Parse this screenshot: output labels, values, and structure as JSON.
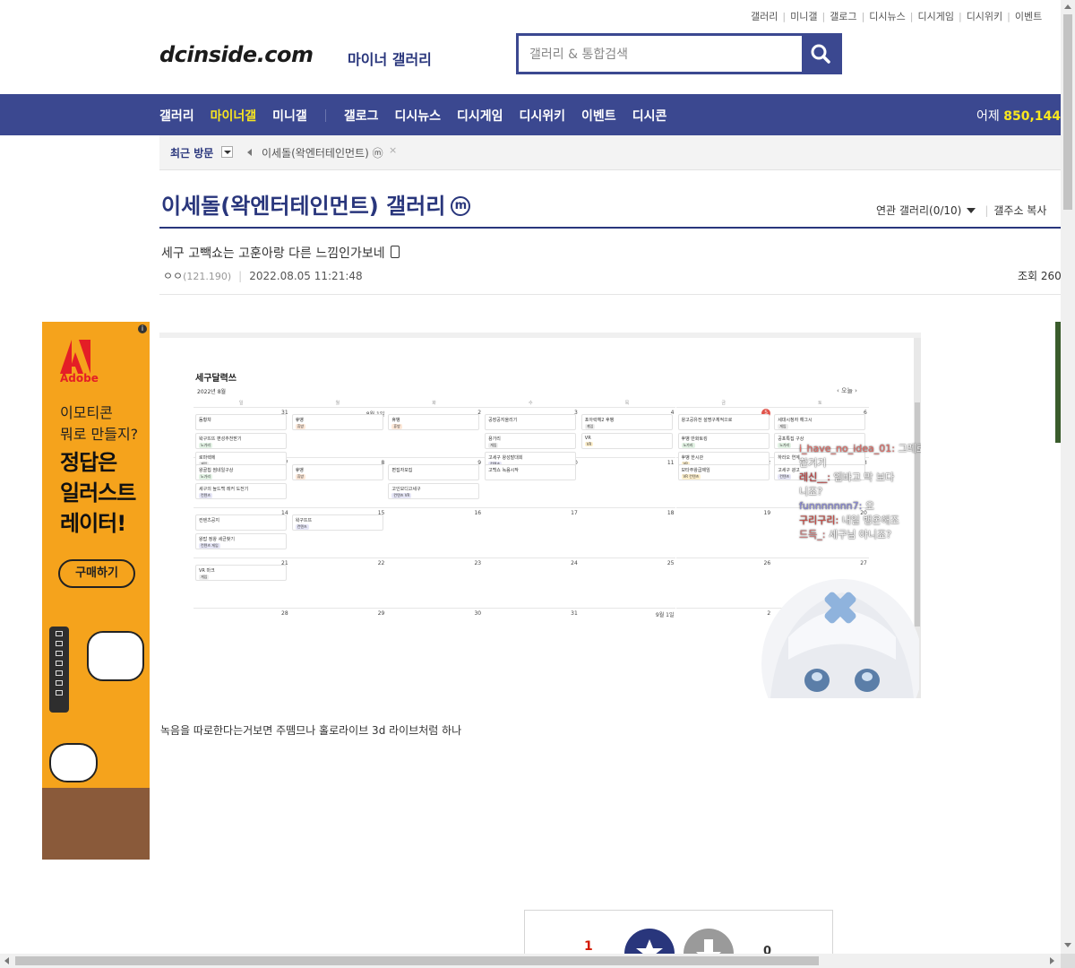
{
  "top_links": [
    "갤러리",
    "미니갤",
    "갤로그",
    "디시뉴스",
    "디시게임",
    "디시위키",
    "이벤트"
  ],
  "logo": {
    "text": "dcinside.com",
    "sub": "마이너 갤러리"
  },
  "search": {
    "placeholder": "갤러리 & 통합검색",
    "icon": "search-icon"
  },
  "nav": {
    "items": [
      "갤러리",
      "마이너갤",
      "미니갤",
      "갤로그",
      "디시뉴스",
      "디시게임",
      "디시위키",
      "이벤트",
      "디시콘"
    ],
    "active_index": 1,
    "yesterday_label": "어제",
    "yesterday_count": "850,144",
    "bg_color": "#3b4890",
    "active_color": "#f9e71f"
  },
  "recent": {
    "label": "최근 방문",
    "item": "이세돌(왁엔터테인먼트)",
    "item_badge": "ⓜ",
    "close": "×"
  },
  "gallery": {
    "title": "이세돌(왁엔터테인먼트) 갤러리",
    "minor_badge": "m",
    "related": "연관 갤러리(0/10)",
    "copy_address": "갤주소 복사"
  },
  "post": {
    "title": "세구 고빽쇼는 고훈아랑 다른 느낌인가보네",
    "author": "ㅇㅇ",
    "ip": "(121.190)",
    "datetime": "2022.08.05 11:21:48",
    "views": "조회 260",
    "body": "녹음을 따로한다는거보면 주뗌므나 홀로라이브 3d 라이브처럼 하나"
  },
  "embedded_image": {
    "calendar_title": "세구달력쓰",
    "calendar_month": "2022년 8월",
    "calendar_nav": "‹ 오늘 ›",
    "week_days": [
      "일",
      "월",
      "화",
      "수",
      "목",
      "금",
      "토"
    ],
    "weeks": [
      [
        "31",
        "8월 1일",
        "2",
        "3",
        "4",
        "5",
        "6"
      ],
      [
        "7",
        "8",
        "9",
        "10",
        "11",
        "12",
        "13"
      ],
      [
        "14",
        "15",
        "16",
        "17",
        "18",
        "19",
        "20"
      ],
      [
        "21",
        "22",
        "23",
        "24",
        "25",
        "26",
        "27"
      ],
      [
        "28",
        "29",
        "30",
        "31",
        "9월 1일",
        "2",
        "3"
      ]
    ],
    "events": [
      {
        "week": 0,
        "day": 0,
        "slot": 0,
        "text": "돔황챠",
        "tag": ""
      },
      {
        "week": 0,
        "day": 0,
        "slot": 1,
        "text": "왁구뜨뜨 편성추천받기",
        "tag": "노가리"
      },
      {
        "week": 0,
        "day": 0,
        "slot": 2,
        "text": "로마렉에",
        "tag": "게임"
      },
      {
        "week": 0,
        "day": 1,
        "slot": 0,
        "text": "휴뱅",
        "tag": "휴방"
      },
      {
        "week": 0,
        "day": 2,
        "slot": 0,
        "text": "휴뱅",
        "tag": "휴방"
      },
      {
        "week": 0,
        "day": 3,
        "slot": 0,
        "text": "공장공지올리기",
        "tag": ""
      },
      {
        "week": 0,
        "day": 3,
        "slot": 1,
        "text": "용가리",
        "tag": "게임"
      },
      {
        "week": 0,
        "day": 3,
        "slot": 2,
        "text": "고세구 왕성발대회",
        "tag": "컨텐츠"
      },
      {
        "week": 0,
        "day": 4,
        "slot": 0,
        "text": "포아락헤2 후뱅",
        "tag": "게임"
      },
      {
        "week": 0,
        "day": 4,
        "slot": 1,
        "text": "VR",
        "tag": "VR"
      },
      {
        "week": 0,
        "day": 5,
        "slot": 0,
        "text": "왕고공유전 설명구체적으로",
        "tag": ""
      },
      {
        "week": 0,
        "day": 5,
        "slot": 1,
        "text": "후뱅 만화토킹",
        "tag": "노가리"
      },
      {
        "week": 0,
        "day": 5,
        "slot": 2,
        "text": "후뱅 한시관",
        "tag": "VR"
      },
      {
        "week": 0,
        "day": 6,
        "slot": 0,
        "text": "세대시청자 해그시",
        "tag": "게임"
      },
      {
        "week": 0,
        "day": 6,
        "slot": 1,
        "text": "공포특집 구상",
        "tag": "노가리"
      },
      {
        "week": 0,
        "day": 6,
        "slot": 2,
        "text": "하라오 연계",
        "tag": ""
      },
      {
        "week": 1,
        "day": 0,
        "slot": 0,
        "text": "왕골칩 썸네일구상",
        "tag": "노가리"
      },
      {
        "week": 1,
        "day": 0,
        "slot": 1,
        "text": "세구의 늪드백 레커 도전기",
        "tag": "컨텐츠"
      },
      {
        "week": 1,
        "day": 1,
        "slot": 0,
        "text": "휴뱅",
        "tag": "휴방"
      },
      {
        "week": 1,
        "day": 2,
        "slot": 0,
        "text": "편집자모집",
        "tag": ""
      },
      {
        "week": 1,
        "day": 2,
        "slot": 1,
        "text": "고인모디고세구",
        "tag": "컨텐츠 VR"
      },
      {
        "week": 1,
        "day": 3,
        "slot": 0,
        "text": "고백쇼 녹음시작",
        "tag": ""
      },
      {
        "week": 1,
        "day": 5,
        "slot": 0,
        "text": "모타주왕굽제임",
        "tag": "VR 컨텐츠"
      },
      {
        "week": 1,
        "day": 6,
        "slot": 0,
        "text": "고세구 광고",
        "tag": "컨텐츠"
      },
      {
        "week": 2,
        "day": 0,
        "slot": 0,
        "text": "컨텐츠공지",
        "tag": ""
      },
      {
        "week": 2,
        "day": 0,
        "slot": 1,
        "text": "왕밥 정왕 세균찾기",
        "tag": "컨텐츠 게임"
      },
      {
        "week": 2,
        "day": 1,
        "slot": 0,
        "text": "왁구뜨뜨",
        "tag": "컨텐츠"
      },
      {
        "week": 3,
        "day": 0,
        "slot": 0,
        "text": "VR 마크",
        "tag": "게임"
      }
    ],
    "chat": [
      {
        "user": "i_have_no_idea_01",
        "msg": "그레로",
        "extra": "한거기"
      },
      {
        "user": "레신__",
        "msg": "엠바고 막 보다",
        "extra": "니죠?"
      },
      {
        "user": "funnnnnnn7",
        "msg": "오",
        "extra": ""
      },
      {
        "user": "구리구리",
        "msg": "내일 뱅온해조",
        "extra": ""
      },
      {
        "user": "드득_",
        "msg": "세구님 아니죠?",
        "extra": ""
      }
    ]
  },
  "ad": {
    "brand": "Adobe",
    "line1a": "이모티콘",
    "line1b": "뭐로 만들지?",
    "line2a": "정답은",
    "line2b": "일러스트",
    "line2c": "레이터!",
    "cta": "구매하기",
    "info": "i",
    "bg_color": "#f5a31c"
  },
  "recommend": {
    "up": "1",
    "down": "0",
    "up_color": "#29367c",
    "down_color": "#9a9a9a"
  }
}
